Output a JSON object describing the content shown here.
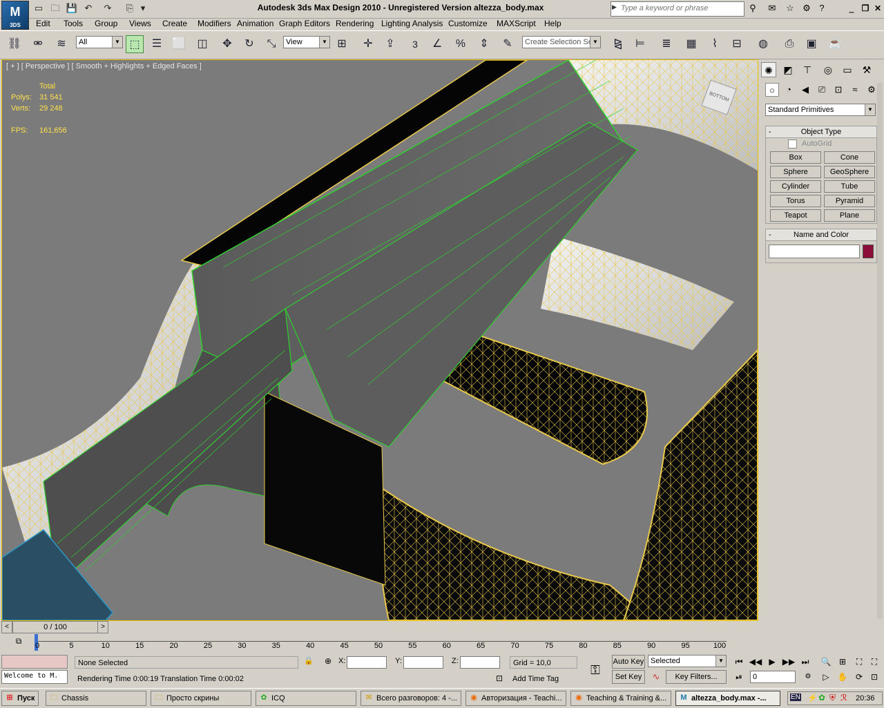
{
  "app": {
    "logo_text": "3DS",
    "title": "Autodesk 3ds Max Design 2010  -  Unregistered Version     altezza_body.max",
    "search_placeholder": "Type a keyword or phrase"
  },
  "menu": [
    "Edit",
    "Tools",
    "Group",
    "Views",
    "Create",
    "Modifiers",
    "Animation",
    "Graph Editors",
    "Rendering",
    "Lighting Analysis",
    "Customize",
    "MAXScript",
    "Help"
  ],
  "toolbar": {
    "selection_filter": "All",
    "reference_coord": "View",
    "named_selection_placeholder": "Create Selection Se",
    "snap_label": "3"
  },
  "viewport": {
    "label": "[ + ] [ Perspective ] [ Smooth + Highlights + Edged Faces ]",
    "stats": {
      "total_label": "Total",
      "polys_label": "Polys:",
      "polys_value": "31 541",
      "verts_label": "Verts:",
      "verts_value": "29 248",
      "fps_label": "FPS:",
      "fps_value": "161,656"
    },
    "viewcube_label": "BOTTOM"
  },
  "command_panel": {
    "category_dropdown": "Standard Primitives",
    "object_type_title": "Object Type",
    "autogrid_label": "AutoGrid",
    "autogrid_checked": false,
    "buttons": [
      "Box",
      "Cone",
      "Sphere",
      "GeoSphere",
      "Cylinder",
      "Tube",
      "Torus",
      "Pyramid",
      "Teapot",
      "Plane"
    ],
    "name_color_title": "Name and Color",
    "name_value": "",
    "object_color": "#8b0d3a"
  },
  "timeline": {
    "frame_display": "0 / 100",
    "ticks": [
      "0",
      "5",
      "10",
      "15",
      "20",
      "25",
      "30",
      "35",
      "40",
      "45",
      "50",
      "55",
      "60",
      "65",
      "70",
      "75",
      "80",
      "85",
      "90",
      "95",
      "100"
    ]
  },
  "status": {
    "maxscript_listener": "Welcome to M.",
    "selection_info": "None Selected",
    "prompt": "Rendering Time  0:00:19    Translation Time  0:00:02",
    "x_label": "X:",
    "y_label": "Y:",
    "z_label": "Z:",
    "grid": "Grid = 10,0",
    "add_time_tag": "Add Time Tag",
    "auto_key": "Auto Key",
    "set_key": "Set Key",
    "key_mode": "Selected",
    "key_filters": "Key Filters...",
    "current_frame": "0"
  },
  "taskbar": {
    "start_label": "Пуск",
    "tasks": [
      "Chassis",
      "Просто скрины",
      "ICQ",
      "Всего разговоров: 4 -...",
      "Авторизация - Teachi...",
      "Teaching & Training &...",
      "altezza_body.max -..."
    ],
    "lang": "EN",
    "clock": "20:36"
  },
  "colors": {
    "viewport_bg": "#7b7b7b",
    "wire_yellow": "#e8c84a",
    "wire_green": "#2fd02f",
    "stats_text": "#ffe14a"
  }
}
